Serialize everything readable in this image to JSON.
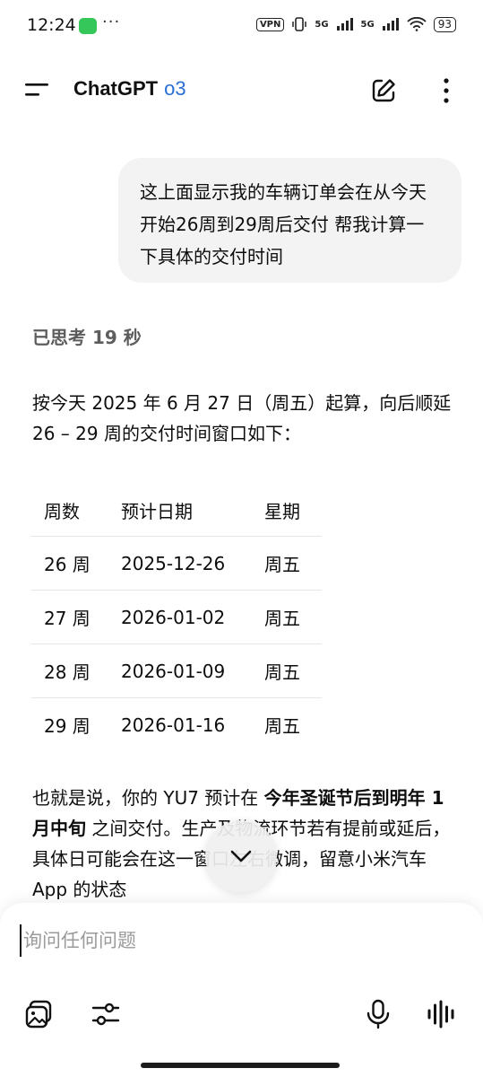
{
  "status_bar": {
    "time": "12:24",
    "dots": "···",
    "vpn": "VPN",
    "net1": "5G",
    "net2": "5G",
    "battery": "93"
  },
  "app_bar": {
    "title": "ChatGPT",
    "model": "o3"
  },
  "user_message": "这上面显示我的车辆订单会在从今天开始26周到29周后交付 帮我计算一下具体的交付时间",
  "thought_label": "已思考 19 秒",
  "answer": {
    "intro": "按今天 2025 年 6 月 27 日（周五）起算，向后顺延 26 – 29 周的交付时间窗口如下：",
    "table": {
      "headers": [
        "周数",
        "预计日期",
        "星期"
      ],
      "rows": [
        [
          "26 周",
          "2025-12-26",
          "周五"
        ],
        [
          "27 周",
          "2026-01-02",
          "周五"
        ],
        [
          "28 周",
          "2026-01-09",
          "周五"
        ],
        [
          "29 周",
          "2026-01-16",
          "周五"
        ]
      ]
    },
    "summary_part1": "也就是说，你的 YU7 预计在 ",
    "summary_bold1": "今年圣诞节后到明年 1 月中旬",
    "summary_part2": " 之间交付。生产及物流环节若有提前或延后，具体日可能会在这一窗口左右微调，留意小米汽车 App 的状态"
  },
  "composer": {
    "placeholder": "询问任何问题"
  },
  "icons": [
    "menu-icon",
    "edit-icon",
    "more-icon",
    "chevron-down-icon",
    "image-gallery-icon",
    "tune-icon",
    "mic-icon",
    "voice-wave-icon"
  ]
}
